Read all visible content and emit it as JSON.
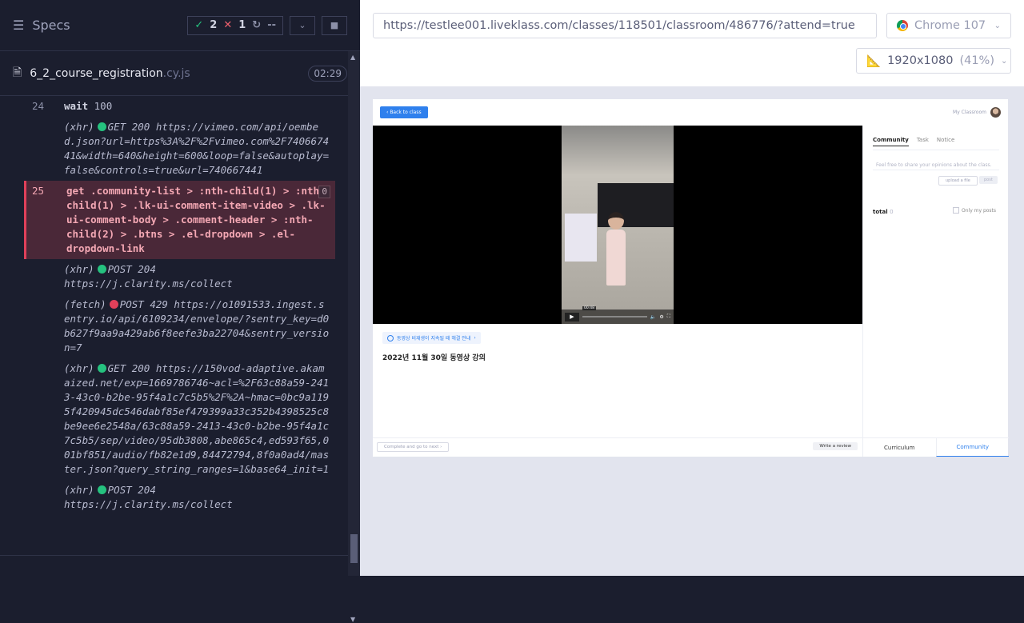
{
  "specs_panel": {
    "title": "Specs",
    "passed": "2",
    "failed": "1",
    "pending": "--",
    "spec_file": "6_2_course_registration",
    "spec_ext": ".cy.js",
    "duration": "02:29"
  },
  "log": [
    {
      "num": "24",
      "cmd": "wait",
      "text": "100"
    },
    {
      "num": "",
      "type": "(xhr)",
      "dot": "green",
      "text": "GET 200 https://vimeo.com/api/oembed.json?url=https%3A%2F%2Fvimeo.com%2F740667441&width=640&height=600&loop=false&autoplay=false&controls=true&url=740667441"
    },
    {
      "num": "25",
      "cmd": "get",
      "text": ".community-list > :nth-child(1) > :nth-child(1) > .lk-ui-comment-item-video > .lk-ui-comment-body > .comment-header > :nth-child(2) > .btns > .el-dropdown > .el-dropdown-link",
      "badge": "0"
    },
    {
      "num": "",
      "type": "(xhr)",
      "dot": "green",
      "text": "POST 204 https://j.clarity.ms/collect"
    },
    {
      "num": "",
      "type": "(fetch)",
      "dot": "red",
      "text": "POST 429 https://o1091533.ingest.sentry.io/api/6109234/envelope/?sentry_key=d0b627f9aa9a429ab6f8eefe3ba22704&sentry_version=7"
    },
    {
      "num": "",
      "type": "(xhr)",
      "dot": "green",
      "text": "GET 200 https://150vod-adaptive.akamaized.net/exp=1669786746~acl=%2F63c88a59-2413-43c0-b2be-95f4a1c7c5b5%2F%2A~hmac=0bc9a1195f420945dc546dabf85ef479399a33c352b4398525c8be9ee6e2548a/63c88a59-2413-43c0-b2be-95f4a1c7c5b5/sep/video/95db3808,abe865c4,ed593f65,001bf851/audio/fb82e1d9,84472794,8f0a0ad4/master.json?query_string_ranges=1&base64_init=1"
    },
    {
      "num": "",
      "type": "(xhr)",
      "dot": "green",
      "text": "POST 204 https://j.clarity.ms/collect"
    }
  ],
  "browser": {
    "url": "https://testlee001.liveklass.com/classes/118501/classroom/486776/?attend=true",
    "name": "Chrome 107",
    "viewport": "1920x1080",
    "scale": "(41%)"
  },
  "app": {
    "back_label": "Back to class",
    "my_classroom": "My Classroom",
    "video_time": "00:48",
    "notice": "동영상 비재생이 지속될 때 해결 안내",
    "video_title": "2022년 11월 30일 동영상 강의",
    "complete_label": "Complete and go to next",
    "review_label": "Write a review",
    "tabs": [
      "Community",
      "Task",
      "Notice"
    ],
    "comment_placeholder": "Feel free to share your opinions about the class.",
    "upload_label": "upload a file",
    "post_label": "post",
    "total_label": "total",
    "total_count": "0",
    "only_my_posts": "Only my posts",
    "bottom_tabs": [
      "Curriculum",
      "Community"
    ]
  }
}
